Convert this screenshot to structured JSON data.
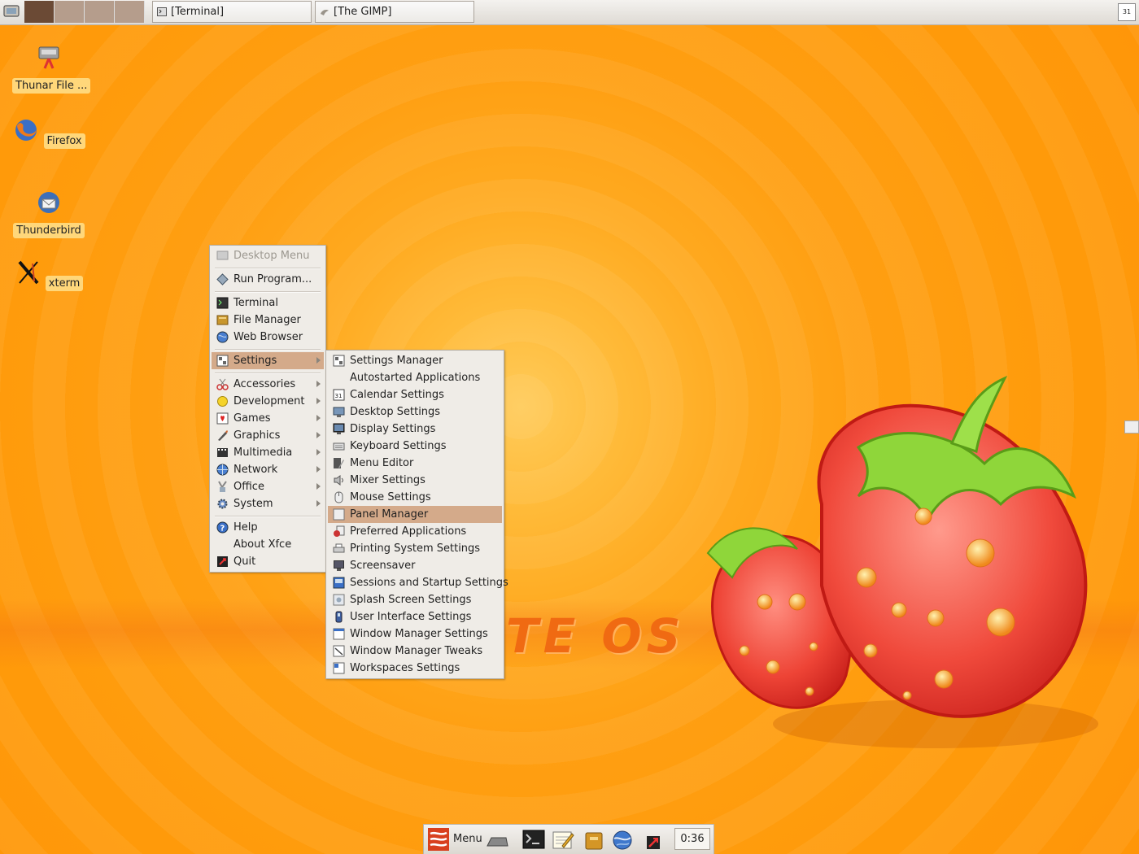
{
  "top_panel": {
    "tasks": [
      "[Terminal]",
      "[The GIMP]"
    ],
    "calendar_glyph": "31"
  },
  "desktop_icons": [
    {
      "label": "Thunar File ...",
      "icon": "file-manager-icon"
    },
    {
      "label": "Firefox",
      "icon": "firefox-icon"
    },
    {
      "label": "Thunderbird",
      "icon": "thunderbird-icon"
    },
    {
      "label": "xterm",
      "icon": "xterm-icon"
    }
  ],
  "desktop_menu": {
    "title": "Desktop Menu",
    "items": [
      "Run Program...",
      "Terminal",
      "File Manager",
      "Web Browser",
      "Settings",
      "Accessories",
      "Development",
      "Games",
      "Graphics",
      "Multimedia",
      "Network",
      "Office",
      "System",
      "Help",
      "About Xfce",
      "Quit"
    ]
  },
  "settings_menu": {
    "items": [
      "Settings Manager",
      "Autostarted Applications",
      "Calendar Settings",
      "Desktop Settings",
      "Display Settings",
      "Keyboard Settings",
      "Menu Editor",
      "Mixer Settings",
      "Mouse Settings",
      "Panel Manager",
      "Preferred Applications",
      "Printing System Settings",
      "Screensaver",
      "Sessions and Startup Settings",
      "Splash Screen Settings",
      "User Interface Settings",
      "Window Manager Settings",
      "Window Manager Tweaks",
      "Workspaces Settings"
    ],
    "highlighted": "Panel Manager"
  },
  "wallpaper": {
    "logo_text": "TE OS"
  },
  "bottom_panel": {
    "menu_label": "Menu",
    "clock": "0:36"
  },
  "colors": {
    "highlight": "#d4aa8a",
    "desktop": "#ff9f12",
    "menu_bg": "#efece7"
  }
}
